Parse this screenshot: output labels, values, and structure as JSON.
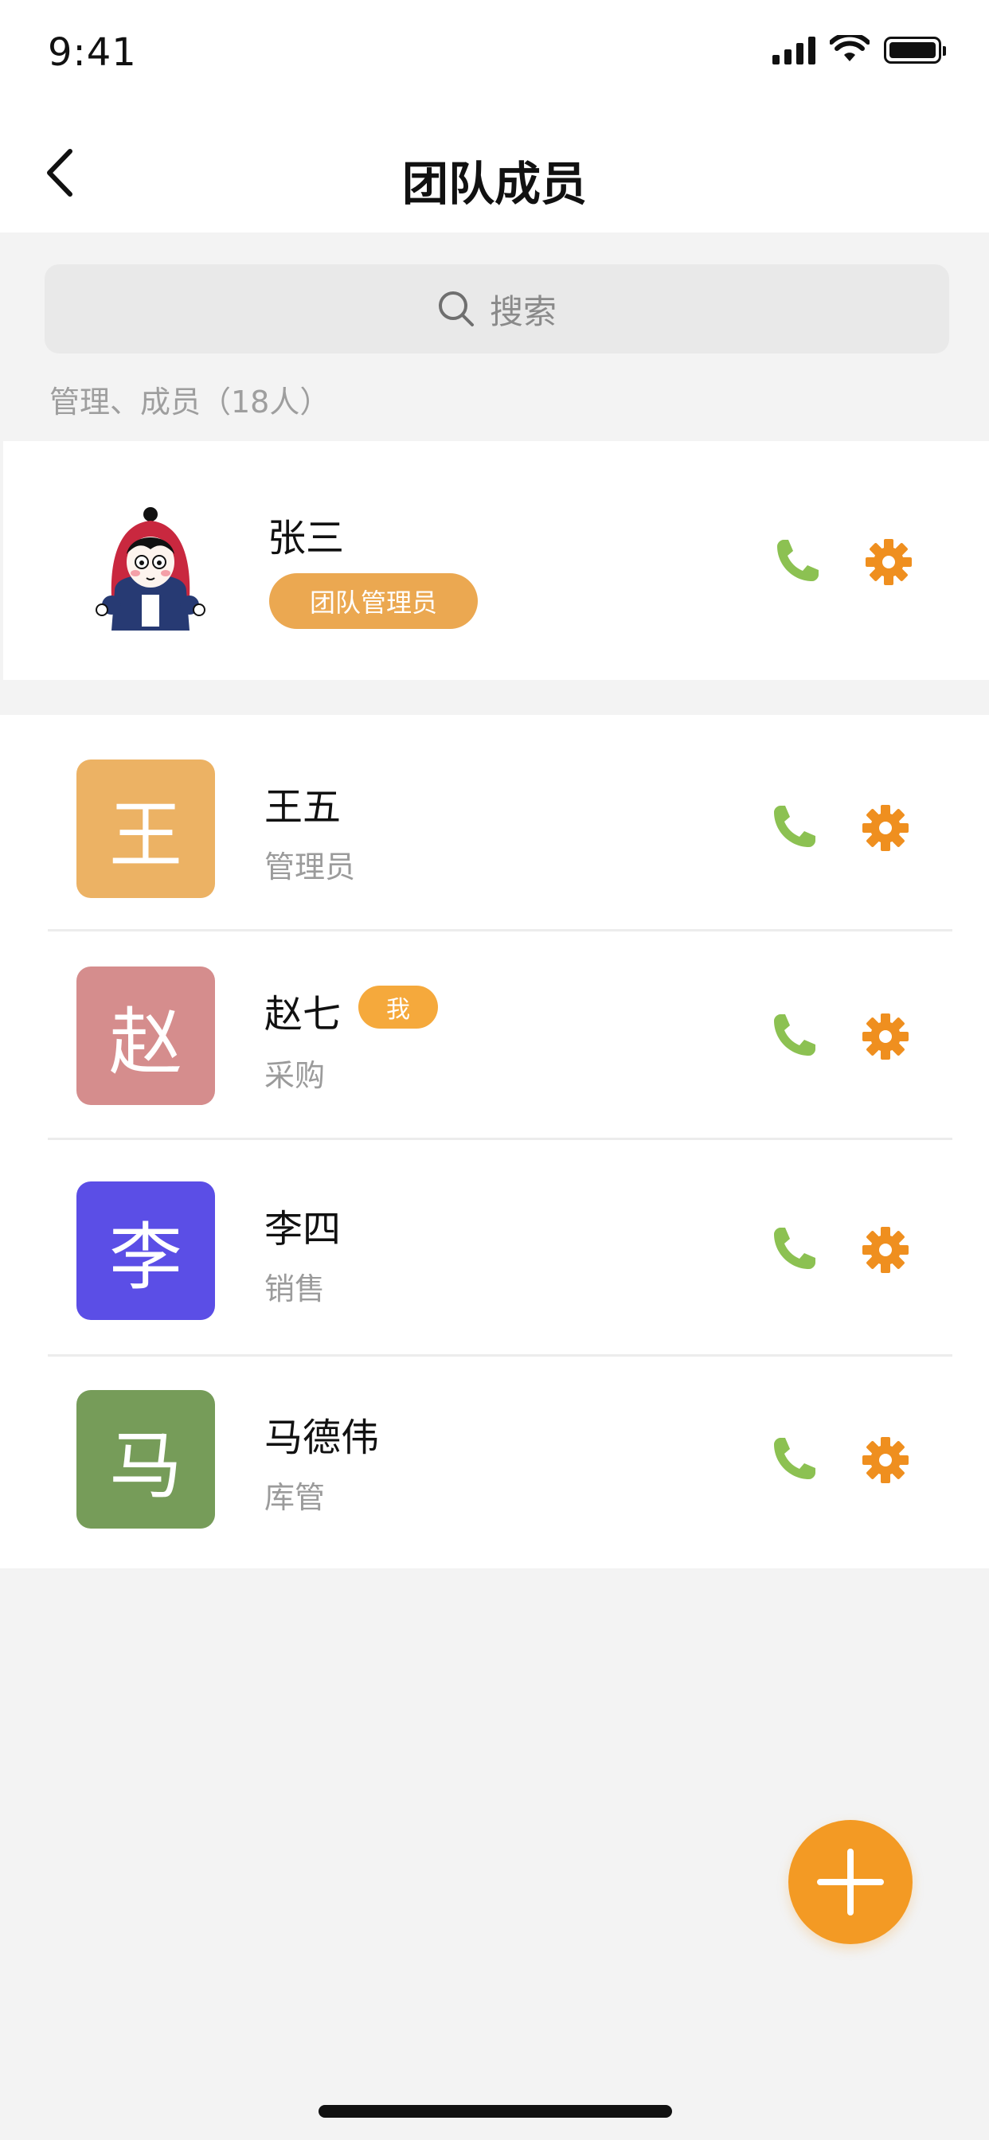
{
  "status_bar": {
    "time": "9:41"
  },
  "nav": {
    "title": "团队成员"
  },
  "search": {
    "placeholder": "搜索"
  },
  "section": {
    "caption": "管理、成员（18人）"
  },
  "admin": {
    "name": "张三",
    "badge": "团队管理员"
  },
  "members": [
    {
      "initial": "王",
      "name": "王五",
      "role": "管理员",
      "color": "#ecb264",
      "is_me": false
    },
    {
      "initial": "赵",
      "name": "赵七",
      "role": "采购",
      "color": "#d58d8d",
      "is_me": true,
      "me_badge": "我"
    },
    {
      "initial": "李",
      "name": "李四",
      "role": "销售",
      "color": "#5b4ee6",
      "is_me": false
    },
    {
      "initial": "马",
      "name": "马德伟",
      "role": "库管",
      "color": "#769c59",
      "is_me": false
    }
  ],
  "colors": {
    "accent": "#f39a24",
    "phone": "#8cc152",
    "gear": "#ef8f1f"
  },
  "icons": {
    "back": "chevron-left-icon",
    "search": "search-icon",
    "phone": "phone-icon",
    "settings": "gear-icon",
    "add": "plus-icon"
  }
}
